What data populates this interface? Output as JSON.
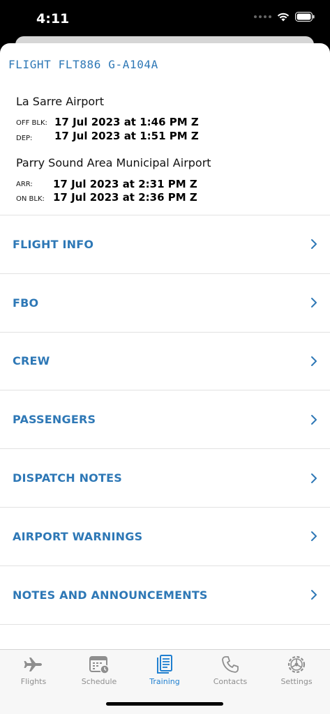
{
  "status_bar": {
    "time": "4:11"
  },
  "flight": {
    "title": "FLIGHT FLT886 G-A104A",
    "departure": {
      "airport": "La Sarre Airport",
      "off_blk_label": "OFF BLK:",
      "off_blk_value": "17 Jul 2023 at 1:46 PM Z",
      "dep_label": "DEP:",
      "dep_value": "17 Jul 2023 at 1:51 PM Z"
    },
    "arrival": {
      "airport": "Parry Sound Area Municipal Airport",
      "arr_label": "ARR:",
      "arr_value": "17 Jul 2023 at 2:31 PM Z",
      "on_blk_label": "ON BLK:",
      "on_blk_value": "17 Jul 2023 at 2:36 PM Z"
    }
  },
  "menu": {
    "items": [
      {
        "label": "FLIGHT INFO"
      },
      {
        "label": "FBO"
      },
      {
        "label": "CREW"
      },
      {
        "label": "PASSENGERS"
      },
      {
        "label": "DISPATCH NOTES"
      },
      {
        "label": "AIRPORT WARNINGS"
      },
      {
        "label": "NOTES AND ANNOUNCEMENTS"
      }
    ]
  },
  "tab_bar": {
    "tabs": [
      {
        "label": "Flights",
        "icon": "airplane-icon"
      },
      {
        "label": "Schedule",
        "icon": "calendar-clock-icon"
      },
      {
        "label": "Training",
        "icon": "document-icon",
        "active": true
      },
      {
        "label": "Contacts",
        "icon": "phone-icon"
      },
      {
        "label": "Settings",
        "icon": "gear-icon"
      }
    ]
  },
  "colors": {
    "accent": "#2e78b6",
    "active_tab": "#1f7fd0",
    "inactive_tab": "#8e8e8e"
  }
}
